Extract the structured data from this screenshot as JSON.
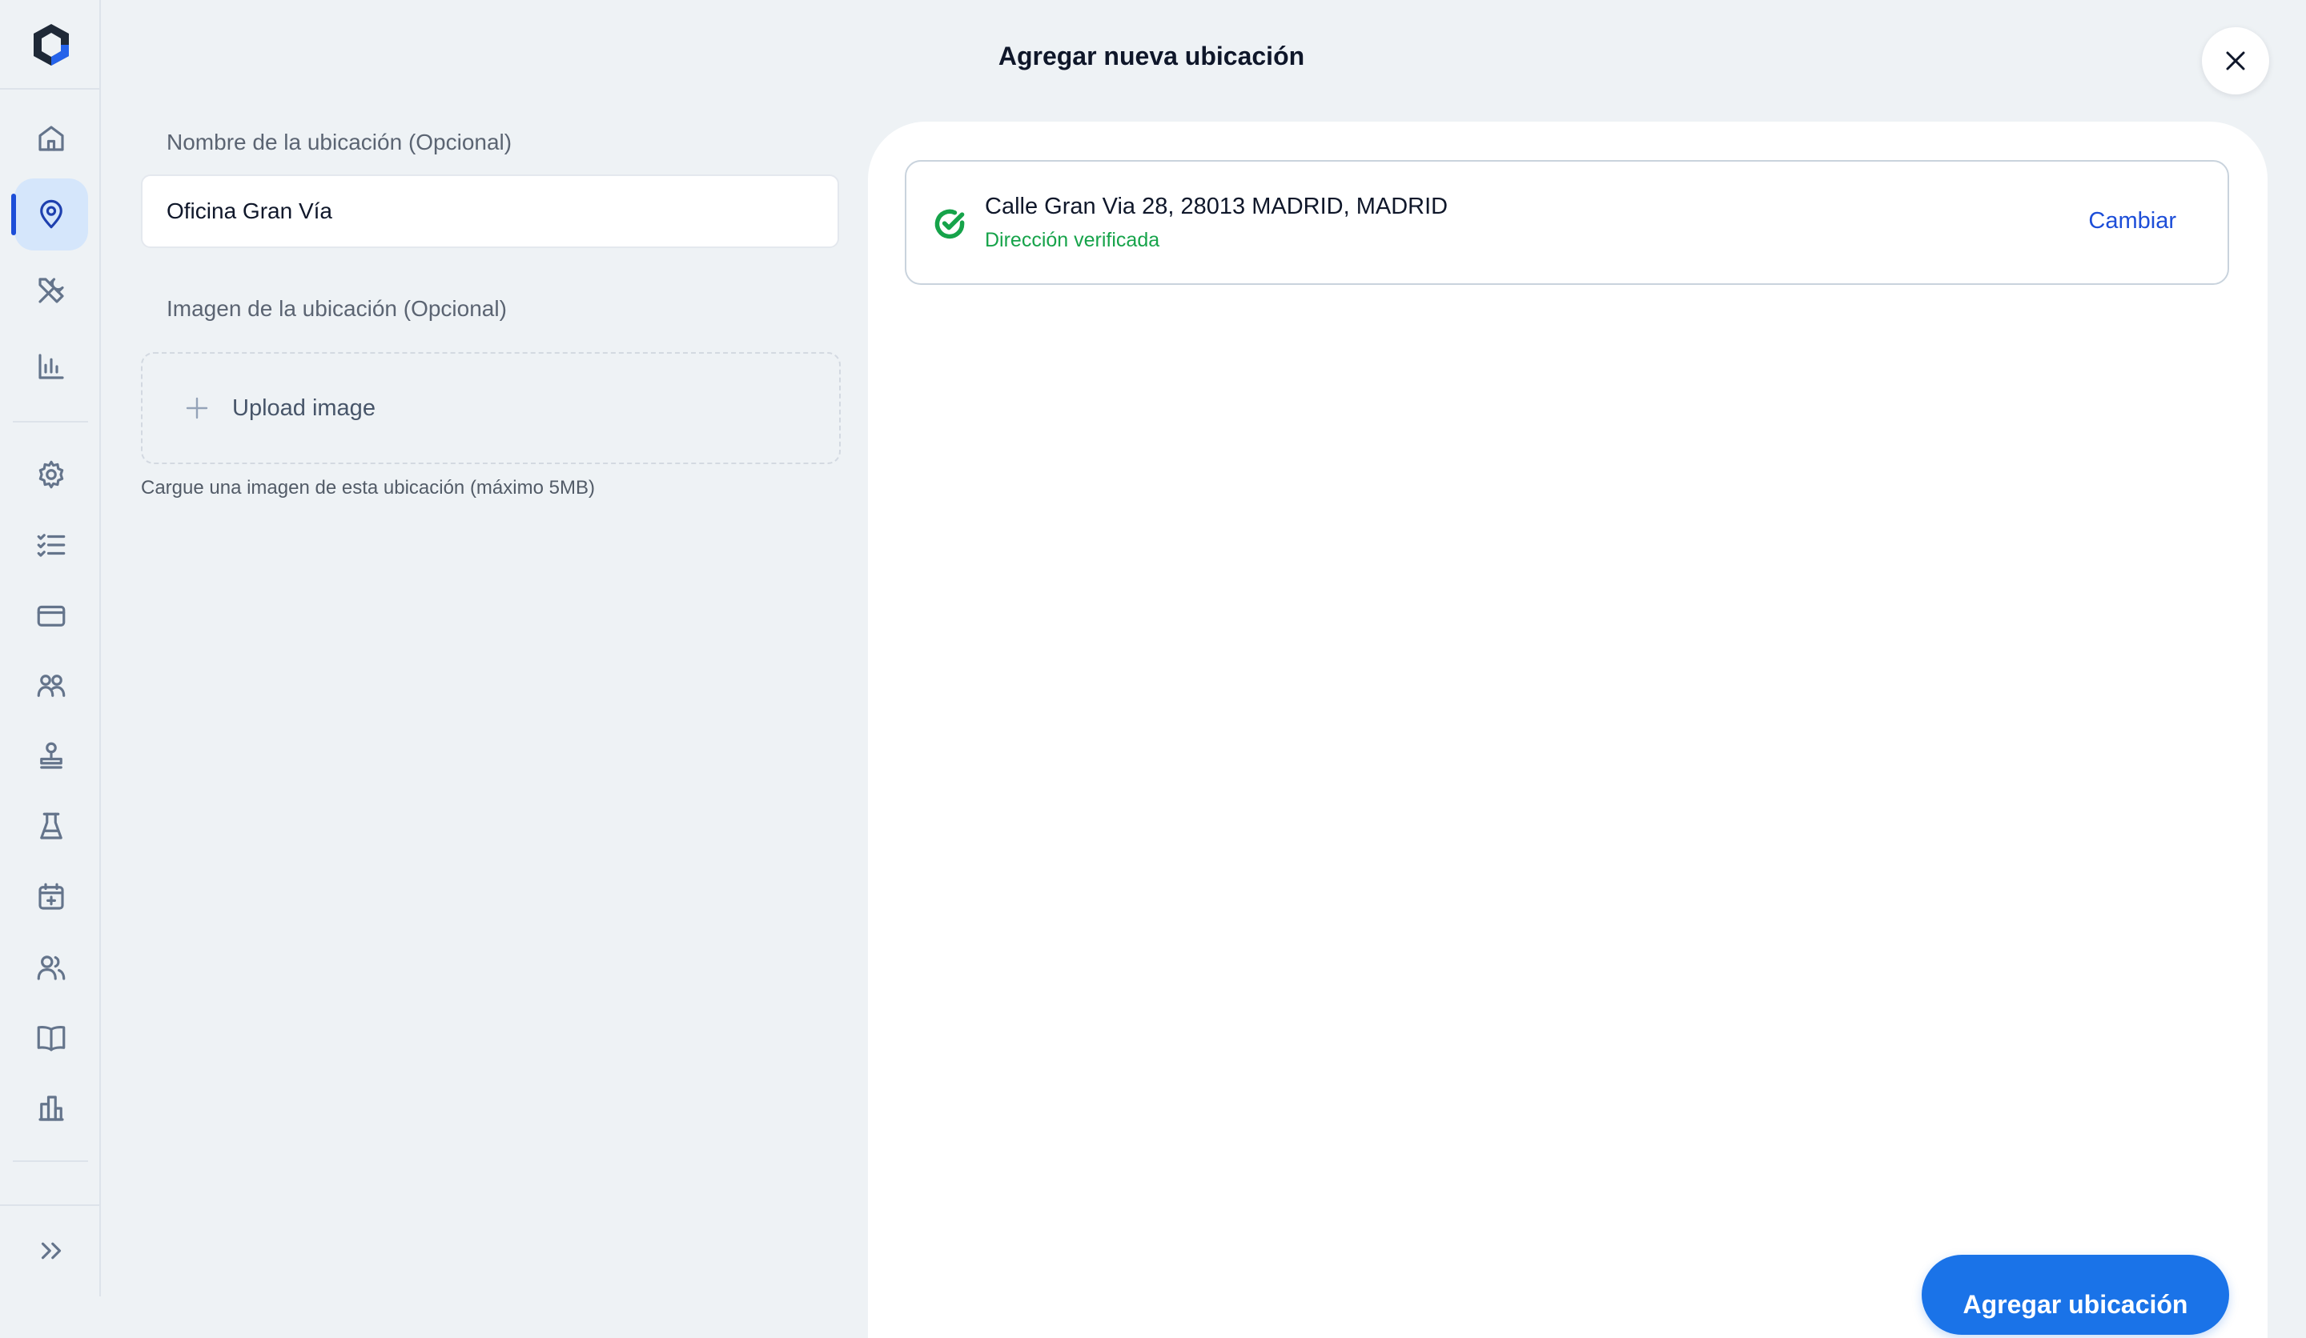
{
  "header": {
    "title": "Agregar nueva ubicación"
  },
  "form": {
    "name_label": "Nombre de la ubicación (Opcional)",
    "name_value": "Oficina Gran Vía",
    "image_label": "Imagen de la ubicación (Opcional)",
    "upload_label": "Upload image",
    "upload_help": "Cargue una imagen de esta ubicación (máximo 5MB)"
  },
  "address": {
    "line": "Calle Gran Via 28, 28013 MADRID, MADRID",
    "status": "Dirección verificada",
    "change_label": "Cambiar"
  },
  "actions": {
    "submit_label": "Agregar ubicación"
  },
  "sidebar": {
    "icons": [
      "home-icon",
      "location-pin-icon",
      "tools-icon",
      "bar-chart-icon",
      "gear-icon",
      "checklist-icon",
      "credit-card-icon",
      "group-icon",
      "stamp-icon",
      "lab-flask-icon",
      "calendar-add-icon",
      "users-icon",
      "book-icon",
      "building-icon",
      "expand-icon"
    ],
    "active": "location-pin-icon"
  },
  "colors": {
    "accent": "#1a73e8",
    "verified": "#16a34a",
    "link": "#1d4ed8"
  }
}
